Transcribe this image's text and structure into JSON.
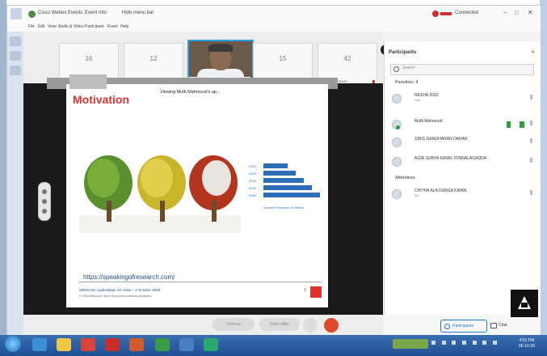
{
  "window": {
    "title": "Cisco Webex Events",
    "menu_tabs": [
      "Event Info",
      "Hide menu bar"
    ],
    "connection_status": "Connected",
    "controls": [
      "–",
      "□",
      "✕"
    ]
  },
  "menu": {
    "items": [
      "File",
      "Edit",
      "View",
      "Audio & Video",
      "Participant",
      "Event",
      "Help"
    ]
  },
  "thumbnails": [
    {
      "num": "16",
      "name": "SHOVEL ELANGO...",
      "mic_muted": true
    },
    {
      "num": "12",
      "name": "RESHMA K...",
      "mic_muted": true
    },
    {
      "num": "",
      "name": "Mufti Mahmoud",
      "mic_muted": true,
      "active": true
    },
    {
      "num": "15",
      "name": "SRIRAJAN HARSHA KUMAR",
      "mic_muted": true
    },
    {
      "num": "42",
      "name": "MEDICATION BEING...",
      "mic_muted": true
    }
  ],
  "stage": {
    "viewing_label": "Viewing Mufti Mahmoud's ap...",
    "slide": {
      "title": "Motivation",
      "chart_years": [
        "2010",
        "2020",
        "2030",
        "2040",
        "2050"
      ],
      "chart_caption": "Alzheimer Research UK Millions",
      "url": "https://speakingofresearch.com/",
      "footer_line1": "SRDIA'20, Hyderabad, AP, India – 4 October 2020",
      "footer_line2": "© 2020 Mahmoud. Not to be produced without permission",
      "page_number": "3"
    }
  },
  "controls": {
    "mute_label": "Unmute",
    "video_label": "Start video"
  },
  "panel": {
    "header": "Participants",
    "close": "✕",
    "search_placeholder": "Search",
    "groups": [
      {
        "label": "Panelists: 4",
        "members": [
          {
            "name": "RESHA 2020",
            "sub": "Host",
            "host": false
          },
          {
            "name": "Mufti Mahmoud",
            "sub": "",
            "host": true
          },
          {
            "name": "SIRIS GANGHARAN DAHAN",
            "sub": ""
          },
          {
            "name": "AGIR SURYA KIRAN JONNALAGADDA",
            "sub": ""
          }
        ]
      },
      {
        "label": "Attendees",
        "members": [
          {
            "name": "CHITHA ALA DURGA KIRAN",
            "sub": "Me"
          }
        ]
      }
    ],
    "footer": {
      "participants_label": "Participants",
      "chat_label": "Chat"
    }
  },
  "taskbar": {
    "clock_time": "4:51 PM",
    "clock_date": "06-10-20"
  },
  "colors": {
    "accent_blue": "#1d7bd6",
    "slide_red": "#e0322d",
    "end_call_red": "#e04a2a",
    "host_green": "#2c9e3a"
  }
}
